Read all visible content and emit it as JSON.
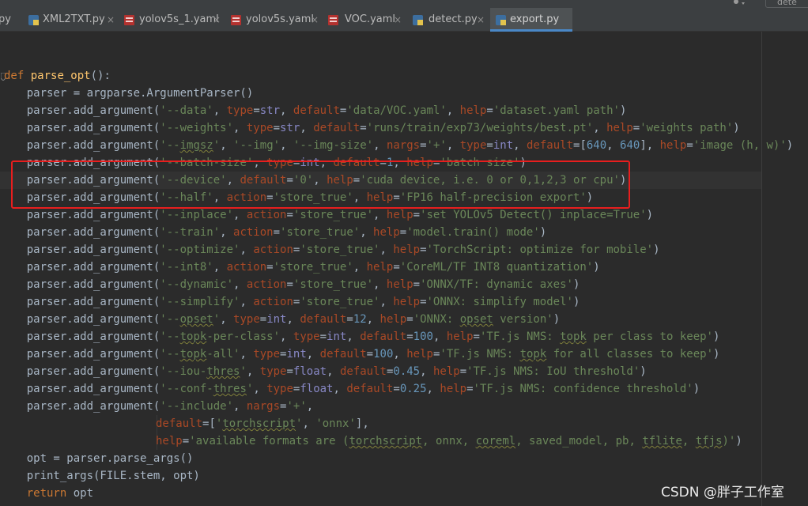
{
  "tabs": [
    {
      "name": "py",
      "label": "py",
      "icon": "none"
    },
    {
      "name": "xml2txt",
      "label": "XML2TXT.py",
      "icon": "python-file-icon"
    },
    {
      "name": "yolov5s-1",
      "label": "yolov5s_1.yaml",
      "icon": "yaml-file-icon"
    },
    {
      "name": "yolov5s",
      "label": "yolov5s.yaml",
      "icon": "yaml-file-icon"
    },
    {
      "name": "voc",
      "label": "VOC.yaml",
      "icon": "yaml-file-icon"
    },
    {
      "name": "detect",
      "label": "detect.py",
      "icon": "python-file-icon"
    },
    {
      "name": "export",
      "label": "export.py",
      "icon": "python-file-icon",
      "active": true
    }
  ],
  "close_glyph": "×",
  "topright_box_label": "dete",
  "code": {
    "line_def_kw": "def",
    "line_def_name": "parse_opt",
    "line_def_rest": "():",
    "line_parser": "    parser = argparse.ArgumentParser()",
    "line_return_kw": "return",
    "line_return_rest": " opt",
    "line_opt": "    opt = parser.parse_args()",
    "line_print": "    print_args(FILE.stem, opt)"
  },
  "args": {
    "call": "    parser.add_argument(",
    "data": "'--data'",
    "data_default": "'data/VOC.yaml'",
    "data_help": "'dataset.yaml path'",
    "weights": "'--weights'",
    "weights_default": "'runs/train/exp73/weights/best.pt'",
    "weights_help": "'weights path'",
    "imgsz_a": "'--",
    "imgsz_b": "imgsz",
    "imgsz_c": "'",
    "img": "'--img'",
    "img_size": "'--img-size'",
    "plus": "'+'",
    "imgsz_default_a": "640",
    "imgsz_default_b": "640",
    "imgsz_help": "'image (h, w)'",
    "batch": "'--batch-size'",
    "batch_default": "1",
    "batch_help": "'batch size'",
    "device": "'--device'",
    "device_default": "'0'",
    "device_help": "'cuda device, i.e. 0 or 0,1,2,3 or cpu'",
    "half": "'--half'",
    "store_true": "'store_true'",
    "half_help": "'FP16 half-precision export'",
    "inplace": "'--inplace'",
    "inplace_help": "'set YOLOv5 Detect() inplace=True'",
    "train": "'--train'",
    "train_help": "'model.train() mode'",
    "optimize": "'--optimize'",
    "optimize_help": "'TorchScript: optimize for mobile'",
    "int8": "'--int8'",
    "int8_help": "'CoreML/TF INT8 quantization'",
    "dynamic": "'--dynamic'",
    "dynamic_help": "'ONNX/TF: dynamic axes'",
    "simplify": "'--simplify'",
    "simplify_help": "'ONNX: simplify model'",
    "opset_a": "'--",
    "opset_b": "opset",
    "opset_c": "'",
    "opset_default": "12",
    "opset_help_a": "'ONNX: ",
    "opset_help_b": "opset",
    "opset_help_c": " version'",
    "topk_pc_a": "'--",
    "topk_pc_b": "topk",
    "topk_pc_c": "-per-class'",
    "topk_pc_default": "100",
    "topk_pc_help_a": "'TF.js NMS: ",
    "topk_pc_help_b": "topk",
    "topk_pc_help_c": " per class to keep'",
    "topk_all_a": "'--",
    "topk_all_b": "topk",
    "topk_all_c": "-all'",
    "topk_all_default": "100",
    "topk_all_help_a": "'TF.js NMS: ",
    "topk_all_help_b": "topk",
    "topk_all_help_c": " for all classes to keep'",
    "iou_a": "'--iou-",
    "iou_b": "thres",
    "iou_c": "'",
    "iou_default": "0.45",
    "iou_help": "'TF.js NMS: IoU threshold'",
    "conf_a": "'--conf-",
    "conf_b": "thres",
    "conf_c": "'",
    "conf_default": "0.25",
    "conf_help": "'TF.js NMS: confidence threshold'",
    "include": "'--include'",
    "include_default_a": "'",
    "include_default_b": "torchscript",
    "include_default_c": "'",
    "include_default_d": "'onnx'",
    "include_help_a": "'available formats are (",
    "include_help_b": "torchscript",
    "include_help_c": ", onnx, ",
    "include_help_d": "coreml",
    "include_help_e": ", saved_model, pb, ",
    "include_help_f": "tflite",
    "include_help_g": ", ",
    "include_help_h": "tfjs",
    "include_help_i": ")'"
  },
  "tokens": {
    "type": "type",
    "default": "default",
    "help": "help",
    "nargs": "nargs",
    "action": "action",
    "str": "str",
    "int": "int",
    "float": "float"
  },
  "watermark": "CSDN @胖子工作室",
  "colors": {
    "keyword": "#cc7832",
    "string": "#6a8759",
    "number": "#6897bb",
    "kwarg": "#aa4926",
    "function": "#ffc66d",
    "highlight_box": "#e81e1e"
  }
}
